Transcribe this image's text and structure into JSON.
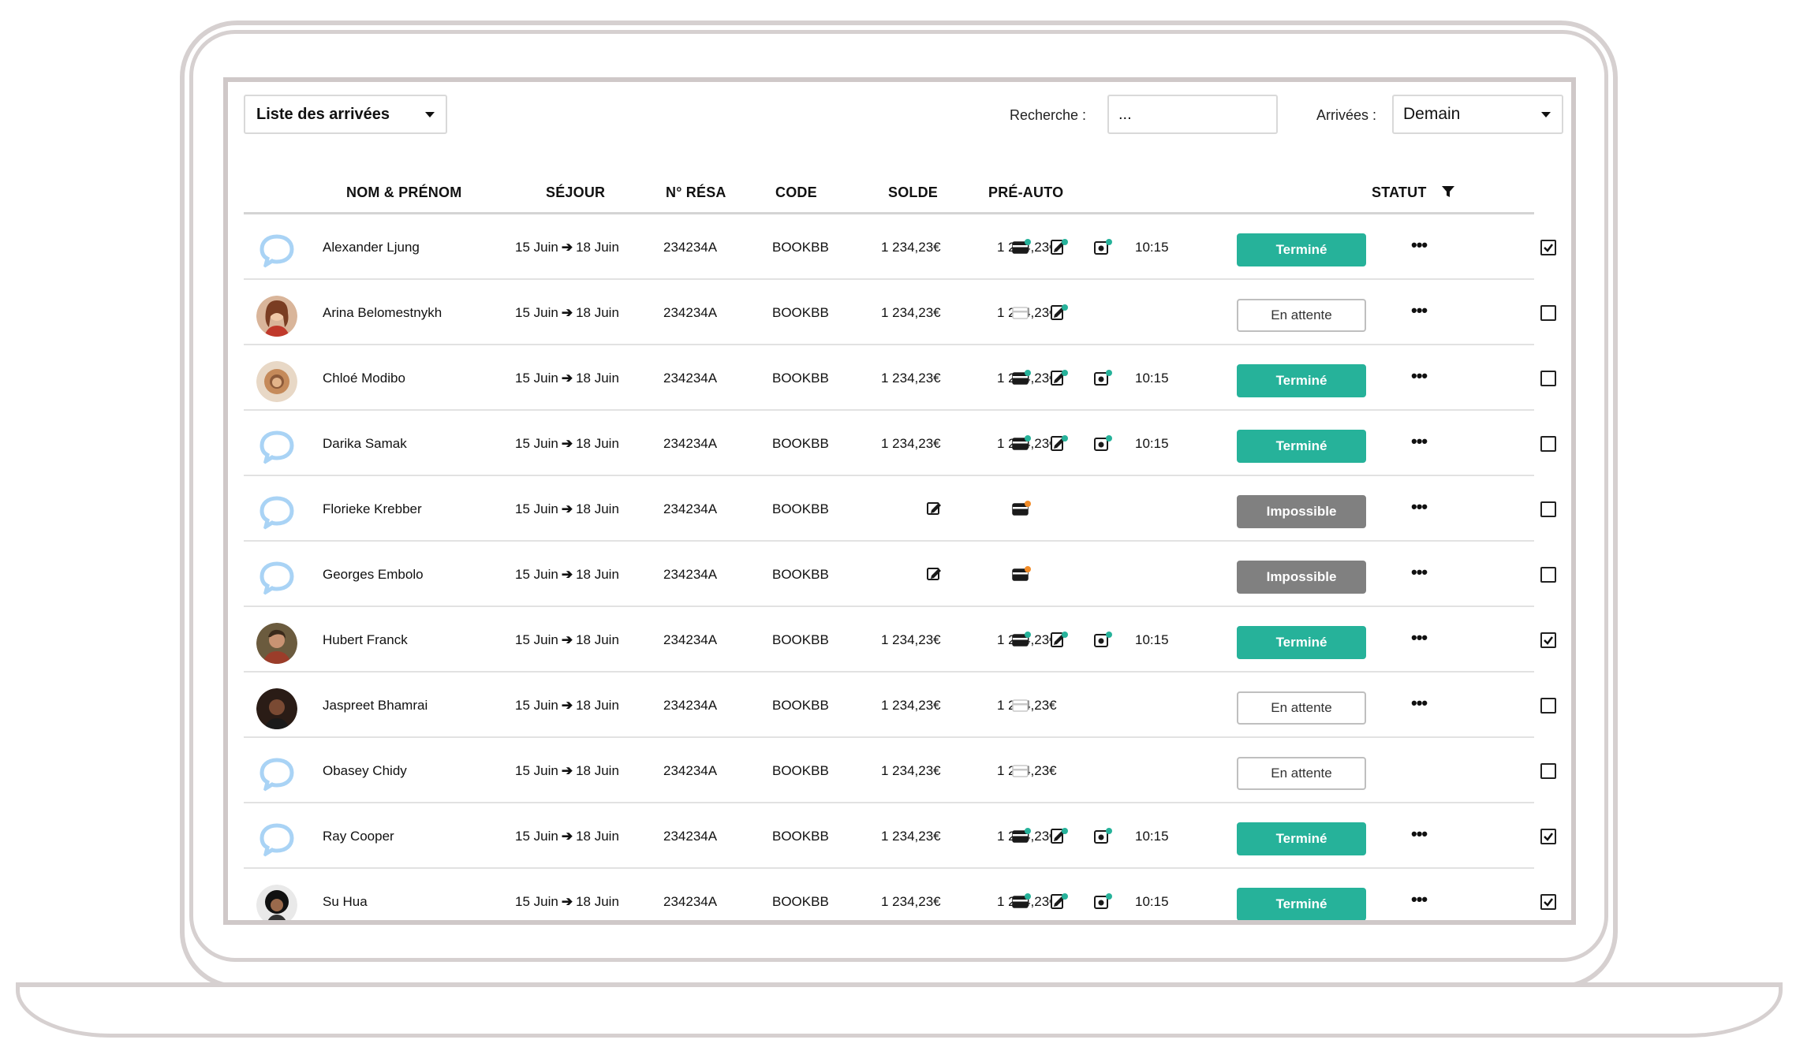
{
  "toolbar": {
    "list_select": "Liste des arrivées",
    "search_label": "Recherche :",
    "search_value": "...",
    "arrivals_label": "Arrivées :",
    "arrivals_select": "Demain"
  },
  "columns": {
    "name": "NOM & PRÉNOM",
    "stay": "SÉJOUR",
    "resa": "N° RÉSA",
    "code": "CODE",
    "balance": "SOLDE",
    "preauth": "PRÉ-AUTO",
    "status": "STATUT"
  },
  "colors": {
    "done": "#26b29a",
    "impossible": "#808080",
    "avatar_placeholder": "#a9d3f5",
    "warning": "#f28c28"
  },
  "rows": [
    {
      "name": "Alexander Ljung",
      "from": "15 Juin",
      "to": "18 Juin",
      "resa": "234234A",
      "code": "BOOKBB",
      "balance": "1 234,23€",
      "preauth": "1 234,23€",
      "time": "10:15",
      "status": "Terminé",
      "avatar": "placeholder"
    },
    {
      "name": "Arina Belomestnykh",
      "from": "15 Juin",
      "to": "18 Juin",
      "resa": "234234A",
      "code": "BOOKBB",
      "balance": "1 234,23€",
      "preauth": "1 234,23€",
      "time": "",
      "status": "En attente",
      "avatar": "photo"
    },
    {
      "name": "Chloé Modibo",
      "from": "15 Juin",
      "to": "18 Juin",
      "resa": "234234A",
      "code": "BOOKBB",
      "balance": "1 234,23€",
      "preauth": "1 234,23€",
      "time": "10:15",
      "status": "Terminé",
      "avatar": "photo"
    },
    {
      "name": "Darika Samak",
      "from": "15 Juin",
      "to": "18 Juin",
      "resa": "234234A",
      "code": "BOOKBB",
      "balance": "1 234,23€",
      "preauth": "1 234,23€",
      "time": "10:15",
      "status": "Terminé",
      "avatar": "placeholder"
    },
    {
      "name": "Florieke Krebber",
      "from": "15 Juin",
      "to": "18 Juin",
      "resa": "234234A",
      "code": "BOOKBB",
      "balance": "",
      "preauth": "",
      "time": "",
      "status": "Impossible",
      "avatar": "placeholder"
    },
    {
      "name": "Georges Embolo",
      "from": "15 Juin",
      "to": "18 Juin",
      "resa": "234234A",
      "code": "BOOKBB",
      "balance": "",
      "preauth": "",
      "time": "",
      "status": "Impossible",
      "avatar": "placeholder"
    },
    {
      "name": "Hubert Franck",
      "from": "15 Juin",
      "to": "18 Juin",
      "resa": "234234A",
      "code": "BOOKBB",
      "balance": "1 234,23€",
      "preauth": "1 234,23€",
      "time": "10:15",
      "status": "Terminé",
      "avatar": "photo"
    },
    {
      "name": "Jaspreet Bhamrai",
      "from": "15 Juin",
      "to": "18 Juin",
      "resa": "234234A",
      "code": "BOOKBB",
      "balance": "1 234,23€",
      "preauth": "1 234,23€",
      "time": "",
      "status": "En attente",
      "avatar": "photo"
    },
    {
      "name": "Obasey Chidy",
      "from": "15 Juin",
      "to": "18 Juin",
      "resa": "234234A",
      "code": "BOOKBB",
      "balance": "1 234,23€",
      "preauth": "1 234,23€",
      "time": "",
      "status": "En attente",
      "avatar": "placeholder"
    },
    {
      "name": "Ray Cooper",
      "from": "15 Juin",
      "to": "18 Juin",
      "resa": "234234A",
      "code": "BOOKBB",
      "balance": "1 234,23€",
      "preauth": "1 234,23€",
      "time": "10:15",
      "status": "Terminé",
      "avatar": "placeholder"
    },
    {
      "name": "Su Hua",
      "from": "15 Juin",
      "to": "18 Juin",
      "resa": "234234A",
      "code": "BOOKBB",
      "balance": "1 234,23€",
      "preauth": "1 234,23€",
      "time": "10:15",
      "status": "Terminé",
      "avatar": "photo"
    }
  ]
}
